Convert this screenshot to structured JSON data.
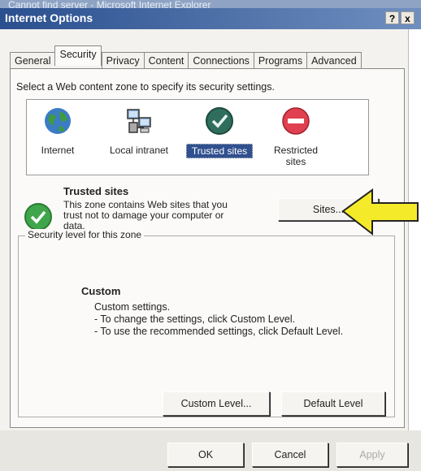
{
  "background_window_title": "Cannot find server - Microsoft Internet Explorer",
  "window": {
    "title": "Internet Options",
    "help_btn": "?",
    "close_btn": "x"
  },
  "tabs": [
    "General",
    "Security",
    "Privacy",
    "Content",
    "Connections",
    "Programs",
    "Advanced"
  ],
  "active_tab": "Security",
  "zone_prompt": "Select a Web content zone to specify its security settings.",
  "zones": [
    {
      "label": "Internet",
      "icon": "globe-icon"
    },
    {
      "label": "Local intranet",
      "icon": "network-computers-icon"
    },
    {
      "label": "Trusted sites",
      "icon": "trusted-check-icon",
      "selected": true
    },
    {
      "label": "Restricted sites",
      "icon": "restricted-icon"
    }
  ],
  "zone_info": {
    "name": "Trusted sites",
    "description": "This zone contains Web sites that you trust not to damage your computer or data.",
    "sites_button": "Sites..."
  },
  "security_level": {
    "group_label": "Security level for this zone",
    "level_name": "Custom",
    "lines": [
      "Custom settings.",
      "- To change the settings, click Custom Level.",
      "- To use the recommended settings, click Default Level."
    ],
    "custom_level_button": "Custom Level...",
    "default_level_button": "Default Level"
  },
  "dialog_buttons": {
    "ok": "OK",
    "cancel": "Cancel",
    "apply": "Apply"
  },
  "colors": {
    "title_bar": "#2a4f8f",
    "selected_zone": "#30508e",
    "annotation_arrow": "#f5ea2a"
  }
}
